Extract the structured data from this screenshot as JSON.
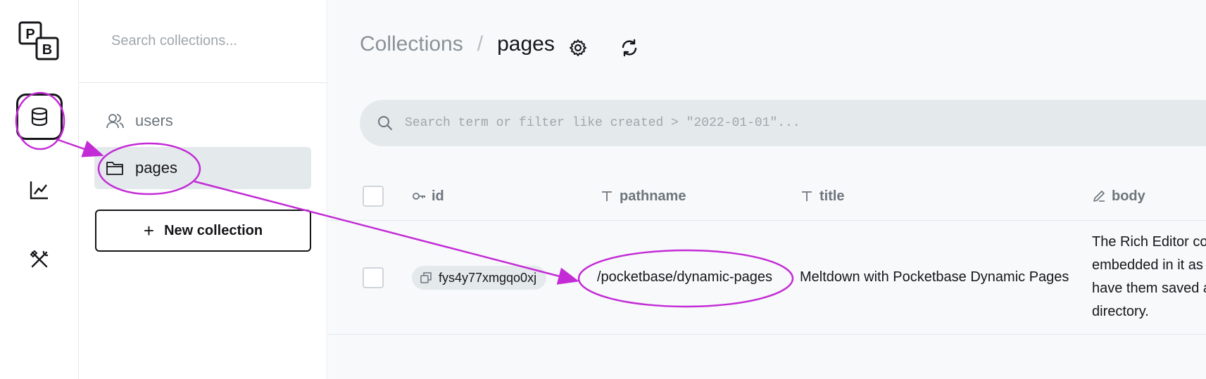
{
  "app": {
    "logo_letters": [
      "P",
      "B"
    ]
  },
  "rail": {
    "items": [
      {
        "name": "collections",
        "icon": "database-icon",
        "active": true
      },
      {
        "name": "logs",
        "icon": "chart-line-icon",
        "active": false
      },
      {
        "name": "settings",
        "icon": "tools-icon",
        "active": false
      }
    ]
  },
  "sidebar": {
    "search_placeholder": "Search collections...",
    "items": [
      {
        "label": "users",
        "icon": "users-icon",
        "active": false
      },
      {
        "label": "pages",
        "icon": "folder-icon",
        "active": true
      }
    ],
    "new_collection_label": "New collection",
    "new_collection_prefix": "+"
  },
  "header": {
    "breadcrumb_root": "Collections",
    "breadcrumb_separator": "/",
    "breadcrumb_current": "pages"
  },
  "search": {
    "placeholder": "Search term or filter like created > \"2022-01-01\"..."
  },
  "table": {
    "columns": [
      {
        "label": "id",
        "icon": "key-icon"
      },
      {
        "label": "pathname",
        "icon": "text-icon"
      },
      {
        "label": "title",
        "icon": "text-icon"
      },
      {
        "label": "body",
        "icon": "pencil-icon"
      }
    ],
    "rows": [
      {
        "id": "fys4y77xmgqo0xj",
        "pathname": "/pocketbase/dynamic-pages",
        "title": "Meltdown with Pocketbase Dynamic Pages",
        "body_lines": [
          "The Rich Editor co",
          "embedded in it as",
          "have them saved a",
          "directory."
        ]
      }
    ]
  },
  "colors": {
    "annotation": "#c32bd6",
    "accent_dark": "#16161a",
    "muted": "#8a9299",
    "panel_bg": "#e4e9ec",
    "main_bg": "#f8f9fa"
  }
}
